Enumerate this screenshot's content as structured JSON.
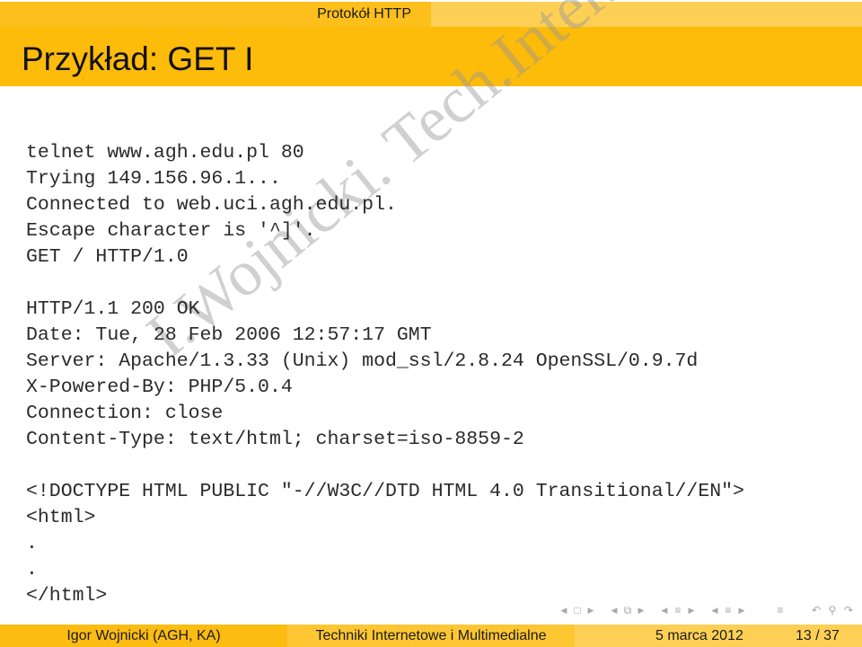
{
  "header": {
    "section": "Protokół HTTP",
    "title": "Przykład: GET I"
  },
  "code_lines": [
    "telnet www.agh.edu.pl 80",
    "Trying 149.156.96.1...",
    "Connected to web.uci.agh.edu.pl.",
    "Escape character is '^]'.",
    "GET / HTTP/1.0",
    "",
    "HTTP/1.1 200 OK",
    "Date: Tue, 28 Feb 2006 12:57:17 GMT",
    "Server: Apache/1.3.33 (Unix) mod_ssl/2.8.24 OpenSSL/0.9.7d",
    "X-Powered-By: PHP/5.0.4",
    "Connection: close",
    "Content-Type: text/html; charset=iso-8859-2",
    "",
    "<!DOCTYPE HTML PUBLIC \"-//W3C//DTD HTML 4.0 Transitional//EN\">",
    "<html>",
    ".",
    ".",
    "</html>"
  ],
  "watermark": "I.Wojnicki. Tech.Inter.",
  "nav": {
    "prev": "◀",
    "next": "▶",
    "frame_icon": "□",
    "subsection_icon": "⧉",
    "section_icon": "≡",
    "align_icon": "≡",
    "back_icon": "↶",
    "search_icon": "⚲",
    "forward_icon": "↷"
  },
  "footer": {
    "author": "Igor Wojnicki  (AGH, KA)",
    "course": "Techniki Internetowe i Multimedialne",
    "date": "5 marca 2012",
    "pages": "13 / 37"
  },
  "colors": {
    "title_bar": "#fdbb0a",
    "top_strip_left": "#fcbf1c",
    "top_strip_right": "#fdd055",
    "footer_1": "#fcbc12",
    "footer_2": "#fdc632",
    "footer_3": "#fdd055"
  }
}
